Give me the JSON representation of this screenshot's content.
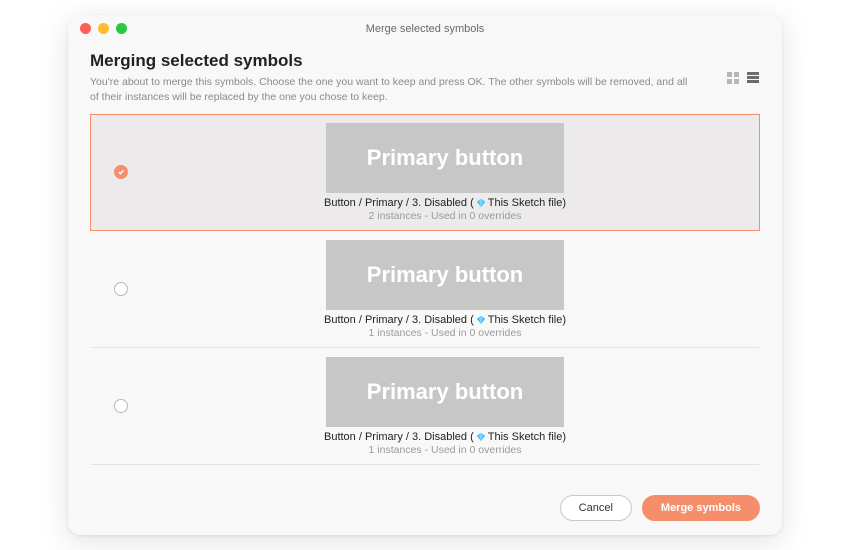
{
  "window_title": "Merge selected symbols",
  "heading": "Merging selected symbols",
  "description": "You're about to merge this symbols. Choose the one you want to keep and press OK. The other symbols will be removed, and all of their instances will be replaced by the one you chose to keep.",
  "items": [
    {
      "preview_label": "Primary button",
      "name_prefix": "Button / Primary / 3. Disabled (",
      "file_label": "This Sketch file)",
      "meta": "2 instances - Used in 0 overrides",
      "selected": true
    },
    {
      "preview_label": "Primary button",
      "name_prefix": "Button / Primary / 3. Disabled (",
      "file_label": "This Sketch file)",
      "meta": "1 instances - Used in 0 overrides",
      "selected": false
    },
    {
      "preview_label": "Primary button",
      "name_prefix": "Button / Primary / 3. Disabled (",
      "file_label": "This Sketch file)",
      "meta": "1 instances - Used in 0 overrides",
      "selected": false
    }
  ],
  "footer": {
    "cancel": "Cancel",
    "merge": "Merge symbols"
  },
  "colors": {
    "accent": "#f58f6b"
  }
}
